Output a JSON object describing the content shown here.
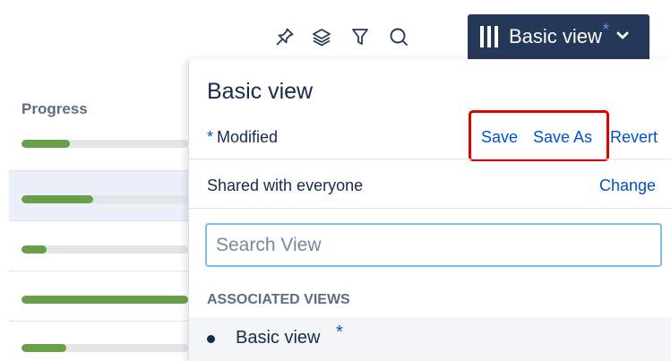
{
  "toolbar": {
    "icons": [
      "pin-icon",
      "layers-icon",
      "filter-icon",
      "search-icon"
    ],
    "view_button": {
      "label": "Basic view",
      "modified_marker": "*",
      "icon": "columns-icon",
      "caret": "chevron-down-icon"
    }
  },
  "table": {
    "column_header": "Progress",
    "rows": [
      {
        "progress": 0.29,
        "highlighted": false
      },
      {
        "progress": 0.43,
        "highlighted": true
      },
      {
        "progress": 0.15,
        "highlighted": false
      },
      {
        "progress": 1.0,
        "highlighted": false
      },
      {
        "progress": 0.27,
        "highlighted": false
      }
    ]
  },
  "panel": {
    "title": "Basic view",
    "modified_marker": "*",
    "modified_label": "Modified",
    "save_label": "Save",
    "save_as_label": "Save As",
    "revert_label": "Revert",
    "shared_label": "Shared with everyone",
    "change_label": "Change",
    "search_placeholder": "Search View",
    "associated_header": "ASSOCIATED VIEWS",
    "views": [
      {
        "label": "Basic view",
        "marker": "*"
      }
    ]
  },
  "colors": {
    "view_button_bg": "#253858",
    "link": "#0052cc",
    "progress_fill": "#6a9f4a",
    "highlight_box": "#e00000"
  }
}
